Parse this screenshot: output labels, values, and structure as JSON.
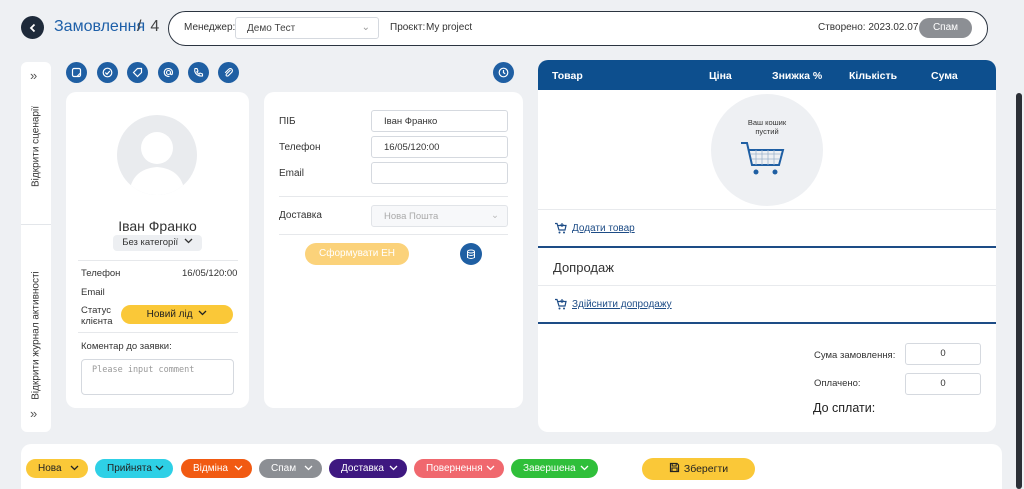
{
  "header": {
    "title": "Замовлення",
    "separator": "/",
    "order_number": "4",
    "manager_label": "Менеджер:",
    "manager_value": "Демо Тест",
    "project_label": "Проєкт:",
    "project_value": "My project",
    "created_text": "Створено: 2023.02.07",
    "spam_label": "Спам"
  },
  "sidebar": {
    "open_scenarios": "Відкрити сценарії",
    "open_activity_log": "Відкрити журнал активності"
  },
  "action_icons": [
    "note-icon",
    "check-circle-icon",
    "tag-icon",
    "at-sign-icon",
    "phone-icon",
    "paperclip-icon",
    "clock-icon"
  ],
  "client": {
    "name": "Іван Франко",
    "category": "Без категорії",
    "phone_label": "Телефон",
    "phone_value": "16/05/120:00",
    "email_label": "Email",
    "status_label_line1": "Статус",
    "status_label_line2": "клієнта",
    "status_value": "Новий лід",
    "comment_label": "Коментар до заявки:",
    "comment_placeholder": "Please input comment"
  },
  "form": {
    "name_label": "ПІБ",
    "name_value": "Іван Франко",
    "phone_label": "Телефон",
    "phone_value": "16/05/120:00",
    "email_label": "Email",
    "email_value": "",
    "delivery_label": "Доставка",
    "delivery_value": "Нова Пошта",
    "generate_button": "Сформувати ЕН"
  },
  "cart": {
    "columns": [
      "Товар",
      "Ціна",
      "Знижка %",
      "Кількість",
      "Сума"
    ],
    "empty_line1": "Ваш кошик",
    "empty_line2": "пустий",
    "add_product": "Додати товар",
    "upsell_title": "Допродаж",
    "do_upsell": "Здійснити допродажу",
    "order_sum_label": "Сума замовлення:",
    "order_sum_value": "0",
    "paid_label": "Оплачено:",
    "paid_value": "0",
    "to_pay_label": "До сплати:"
  },
  "statuses": [
    {
      "label": "Нова",
      "color": "#fac838",
      "text": "#222"
    },
    {
      "label": "Прийнята",
      "color": "#2ed0e6",
      "text": "#222"
    },
    {
      "label": "Відміна",
      "color": "#f15a12",
      "text": "#fff"
    },
    {
      "label": "Спам",
      "color": "#8c8f94",
      "text": "#fff"
    },
    {
      "label": "Доставка",
      "color": "#3e1880",
      "text": "#fff"
    },
    {
      "label": "Повернення",
      "color": "#f0686e",
      "text": "#fff"
    },
    {
      "label": "Завершена",
      "color": "#2fbf3a",
      "text": "#fff"
    }
  ],
  "save_button": "Зберегти"
}
